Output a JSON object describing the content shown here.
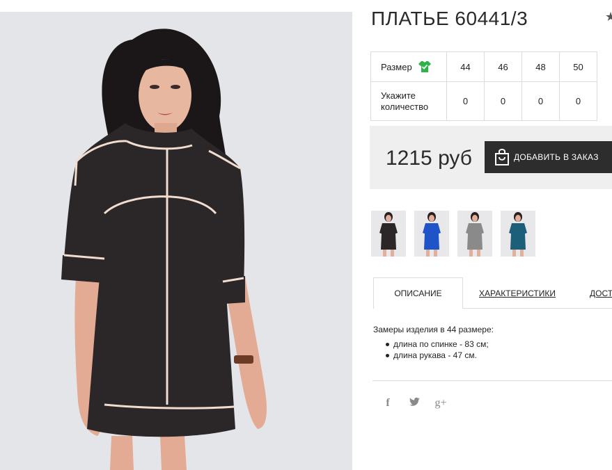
{
  "product": {
    "title": "ПЛАТЬЕ 60441/3",
    "star_glyph": "★",
    "price": "1215 руб",
    "add_to_cart_label": "ДОБАВИТЬ В ЗАКАЗ"
  },
  "sizes_table": {
    "size_row_label": "Размер",
    "quantity_row_label": "Укажите количество",
    "sizes": [
      "44",
      "46",
      "48",
      "50"
    ],
    "quantities": [
      "0",
      "0",
      "0",
      "0"
    ],
    "size_icon": "green-shirt-check-icon",
    "size_icon_color": "#2db34a"
  },
  "thumbnails": [
    {
      "name": "black-dress",
      "color": "#2b2628"
    },
    {
      "name": "blue-dress",
      "color": "#1f54c9"
    },
    {
      "name": "grey-dress",
      "color": "#8a8a8a"
    },
    {
      "name": "teal-dress",
      "color": "#1b5f78"
    }
  ],
  "tabs": [
    {
      "label": "ОПИСАНИЕ",
      "active": true
    },
    {
      "label": "ХАРАКТЕРИСТИКИ",
      "active": false
    },
    {
      "label": "ДОСТ",
      "active": false
    }
  ],
  "description": {
    "intro": "Замеры изделия в 44 размере:",
    "items": [
      "длина по спинке - 83 см;",
      "длина рукава - 47 см."
    ]
  },
  "social": {
    "facebook": "f",
    "twitter": "twitter-bird-icon",
    "google_plus": "g+"
  },
  "colors": {
    "button_bg": "#2d2d2d",
    "price_box_bg": "#efefef",
    "dress_main": "#2b2628",
    "piping": "#f1ddd0"
  }
}
